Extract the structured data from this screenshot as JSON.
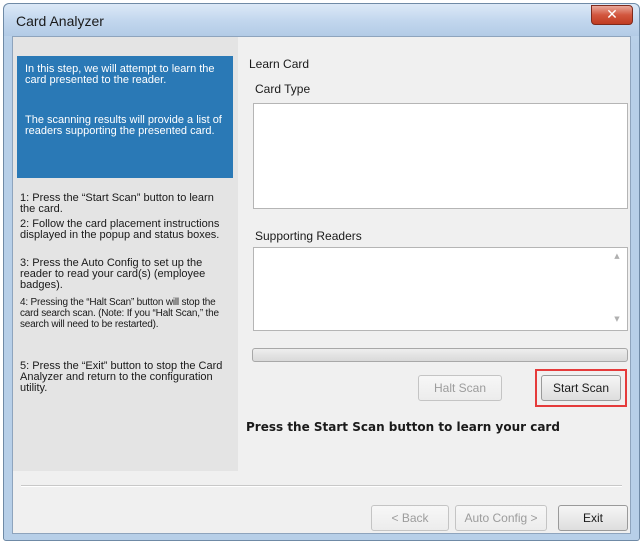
{
  "window": {
    "title": "Card Analyzer",
    "close_glyph": "✕"
  },
  "intro": {
    "paragraph1": "In this step, we will attempt to learn the card presented to the reader.",
    "paragraph2": "The scanning results will provide a list of readers supporting the presented card."
  },
  "steps": [
    "1: Press the “Start Scan” button to learn the card.",
    "2: Follow the card placement instructions displayed in the popup and status boxes.",
    "3: Press the Auto Config to set up the reader to read your card(s) (employee badges).",
    "4: Pressing the “Halt Scan” button will stop the card search scan. (Note: If you “Halt Scan,” the search will need to be restarted).",
    "5: Press the “Exit” button to stop the Card Analyzer and return to the configuration utility."
  ],
  "learn_card": {
    "heading": "Learn Card",
    "card_type_label": "Card Type",
    "card_type_value": "",
    "supporting_readers_label": "Supporting Readers",
    "supporting_readers_value": ""
  },
  "progress": {
    "value": 0
  },
  "buttons": {
    "halt_scan": "Halt Scan",
    "start_scan": "Start Scan",
    "back": "< Back",
    "auto_config": "Auto Config >",
    "exit": "Exit"
  },
  "status": {
    "message": "Press the Start Scan button to learn your card"
  },
  "colors": {
    "intro_background": "#2a79b6",
    "highlight_border": "#e53b3b"
  }
}
